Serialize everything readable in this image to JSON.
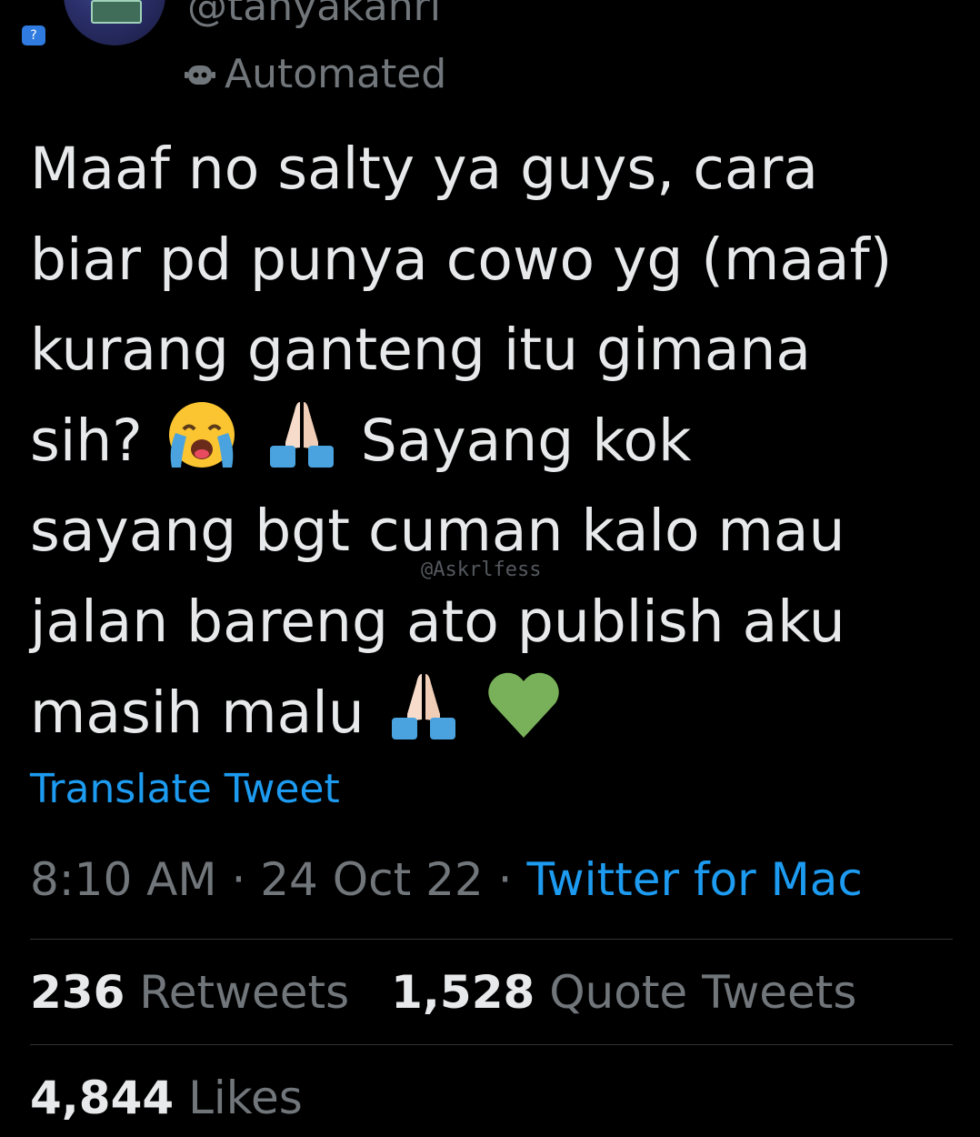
{
  "author": {
    "handle": "@tanyakanrl",
    "automated_label": "Automated"
  },
  "tweet": {
    "lines": [
      "Maaf no salty ya guys, cara",
      "biar pd punya cowo yg (maaf)",
      "kurang ganteng itu gimana",
      "sih?",
      "Sayang kok",
      "sayang bgt cuman kalo mau",
      "jalan bareng ato publish aku",
      "masih malu"
    ],
    "watermark": "@Askrlfess"
  },
  "translate_label": "Translate Tweet",
  "meta": {
    "time": "8:10 AM",
    "separator": "·",
    "date": "24 Oct 22",
    "source": "Twitter for Mac"
  },
  "stats": {
    "retweets_count": "236",
    "retweets_label": "Retweets",
    "quotes_count": "1,528",
    "quotes_label": "Quote Tweets",
    "likes_count": "4,844",
    "likes_label": "Likes"
  },
  "icons": {
    "automated": "robot-icon",
    "emoji_crying": "loudly-crying-face-icon",
    "emoji_pray": "folded-hands-icon",
    "emoji_heart": "green-heart-icon"
  },
  "colors": {
    "background": "#000000",
    "text": "#e7e9ea",
    "muted": "#71767b",
    "link": "#1d9bf0",
    "divider": "#2f3336",
    "heart": "#78b159"
  }
}
